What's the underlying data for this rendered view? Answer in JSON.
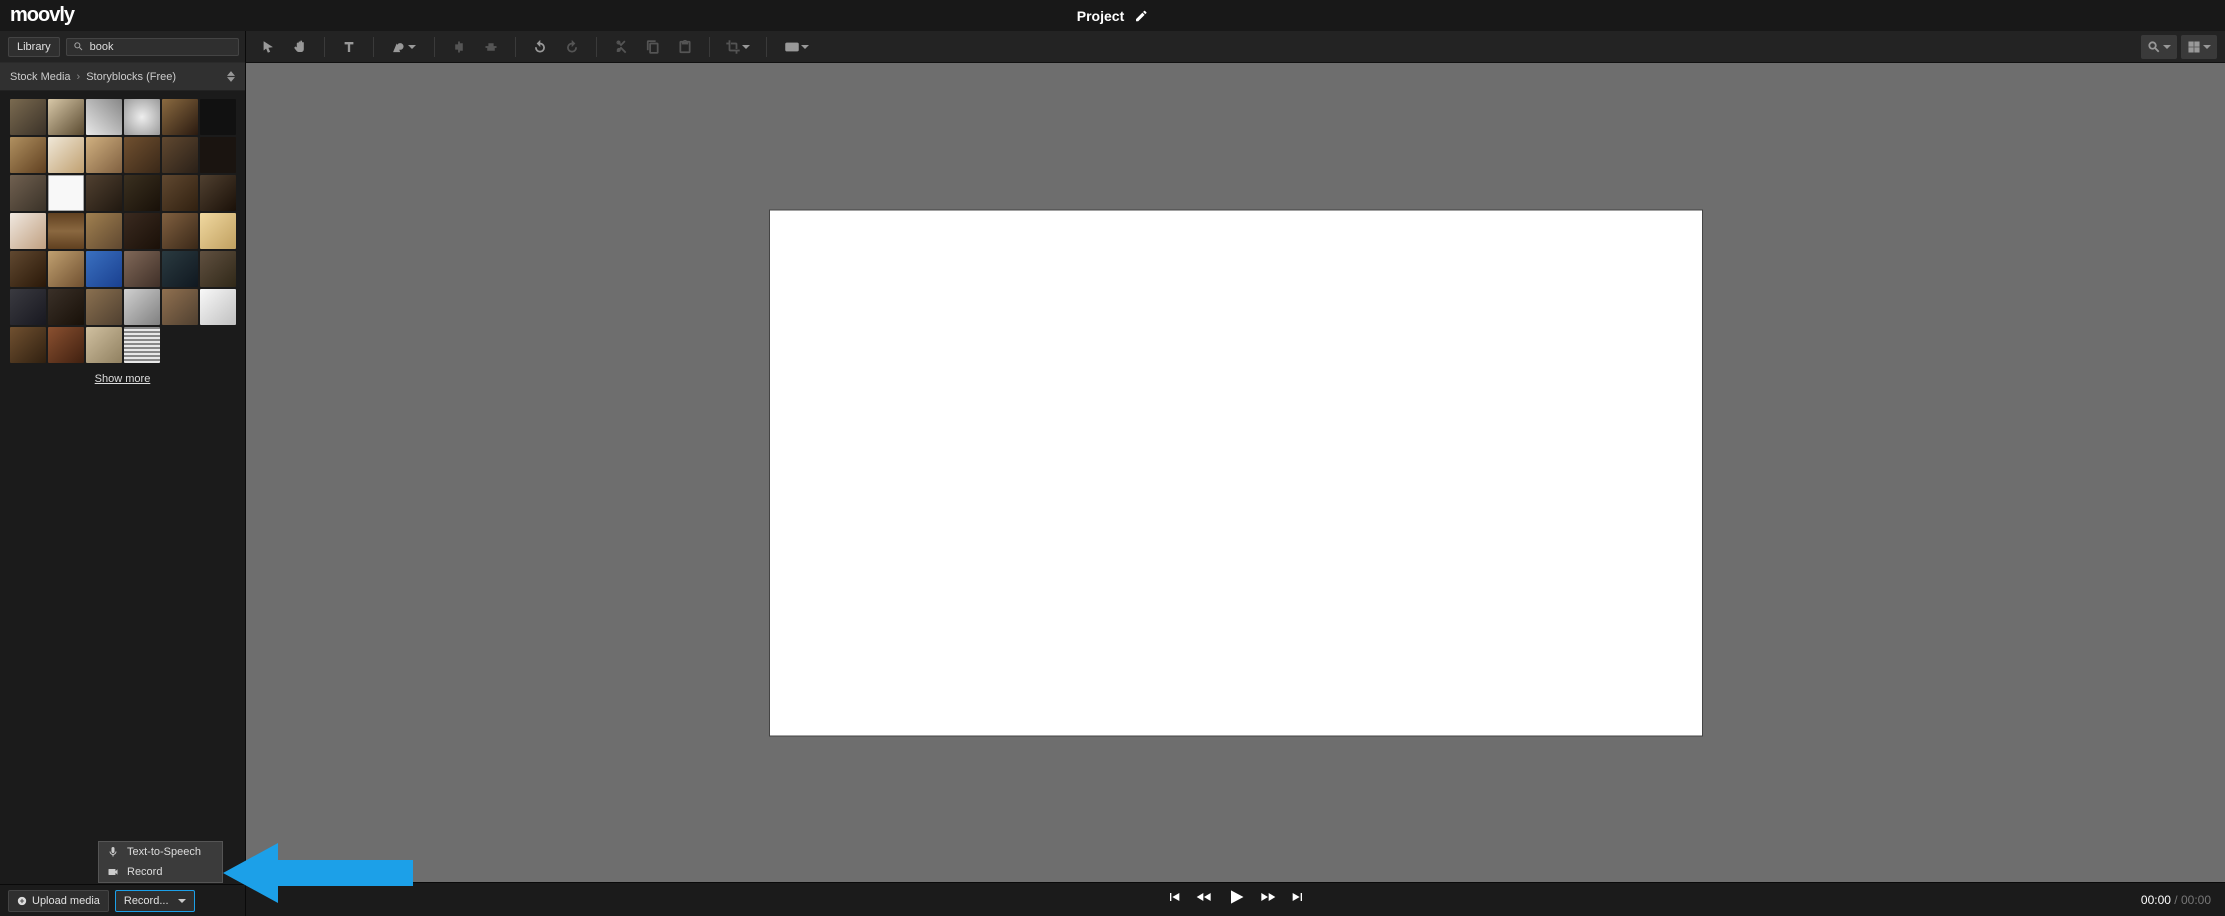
{
  "header": {
    "logo_text": "moovly",
    "project_label": "Project"
  },
  "sidebar": {
    "library_button": "Library",
    "search_value": "book",
    "breadcrumb": {
      "root": "Stock Media",
      "current": "Storyblocks (Free)"
    },
    "show_more": "Show more",
    "thumb_count": 40
  },
  "record_menu": {
    "item1": "Text-to-Speech",
    "item2": "Record"
  },
  "footer": {
    "upload": "Upload media",
    "record": "Record..."
  },
  "playbar": {
    "current": "00:00",
    "total": "00:00"
  },
  "colors": {
    "arrow": "#1ca0e8"
  }
}
